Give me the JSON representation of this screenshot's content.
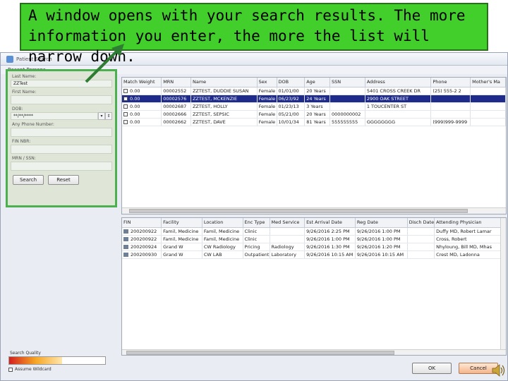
{
  "callout": {
    "line1": "A window opens with your search results.  The more",
    "line2": "information you enter, the more the list will narrow down."
  },
  "window": {
    "title": "Patient Search",
    "subtitle": "Recent Persons"
  },
  "search_panel": {
    "last_name_label": "Last Name:",
    "last_name_value": "ZZTest",
    "first_name_label": "First Name:",
    "first_name_value": "",
    "dob_label": "DOB:",
    "dob_value": "**/**/****",
    "phone_label": "Any Phone Number:",
    "phone_value": "",
    "fin_label": "FIN NBR:",
    "fin_value": "",
    "mrn_label": "MRN / SSN:",
    "mrn_value": "",
    "search_label": "Search",
    "reset_label": "Reset"
  },
  "persons_grid": {
    "columns": [
      "Match Weight",
      "MRN",
      "Name",
      "Sex",
      "DOB",
      "Age",
      "SSN",
      "Address",
      "Phone",
      "Mother's Ma"
    ],
    "rows": [
      [
        "0.00",
        "00002552",
        "ZZTEST, DUDDIE SUSAN",
        "Female",
        "01/01/00",
        "20 Years",
        "",
        "5401 CROSS CREEK DR",
        "(25) 555-2 2",
        ""
      ],
      [
        "0.00",
        "00002576",
        "ZZTEST, MCKENZIE",
        "Female",
        "06/23/92",
        "24 Years",
        "",
        "2900 OAK STREET",
        "",
        ""
      ],
      [
        "0.00",
        "00002687",
        "ZZTEST, HOLLY",
        "Female",
        "01/23/13",
        "3 Years",
        "",
        "1 TOUCENTER ST",
        "",
        ""
      ],
      [
        "0.00",
        "00002666",
        "ZZTEST, SEPSIC",
        "Female",
        "05/21/00",
        "20 Years",
        "0000000002",
        "",
        "",
        ""
      ],
      [
        "0.00",
        "00002662",
        "ZZTEST, DAVE",
        "Female",
        "10/01/34",
        "81 Years",
        "555555555",
        "GGGGGGGG",
        "(999)999-9999",
        ""
      ]
    ],
    "selected_row": 1
  },
  "encounters_grid": {
    "columns": [
      "FIN",
      "Facility",
      "Location",
      "Enc Type",
      "Med Service",
      "Est Arrival Date",
      "Reg Date",
      "Disch Date",
      "Attending Physician"
    ],
    "rows": [
      [
        "200200922",
        "Famil, Medicine",
        "Famil, Medicine",
        "Clinic",
        "",
        "9/26/2016 2:25 PM",
        "9/26/2016 1:00 PM",
        "",
        "Duffy MD, Robert Lamar"
      ],
      [
        "200200922",
        "Famil, Medicine",
        "Famil, Medicine",
        "Clinic",
        "",
        "9/26/2016 1:00 PM",
        "9/26/2016 1:00 PM",
        "",
        "Cross, Robert"
      ],
      [
        "200200924",
        "Grand W",
        "CW Radiology",
        "Pricing",
        "Radiology",
        "9/26/2016 1:30 PM",
        "9/26/2016 1:20 PM",
        "",
        "Nhyloung, Bill MD, Mhas"
      ],
      [
        "200200930",
        "Grand W",
        "CW LAB",
        "Outpatient",
        "Laboratory",
        "9/26/2016 10:15 AM",
        "9/26/2016 10:15 AM",
        "",
        "Crest MD, Ladonna"
      ]
    ]
  },
  "footer": {
    "quality_label": "Search Quality",
    "quality_level": 0.55,
    "assume_label": "Assume Wildcard",
    "ok_label": "OK",
    "cancel_label": "Cancel"
  },
  "colors": {
    "callout_bg": "#42cf2c",
    "panel_border": "#4caf50",
    "selected_row": "#1e2b8a"
  },
  "icons": [
    "app-icon",
    "checkbox-icon",
    "encounter-icon",
    "speaker-icon",
    "arrow-pointer"
  ]
}
